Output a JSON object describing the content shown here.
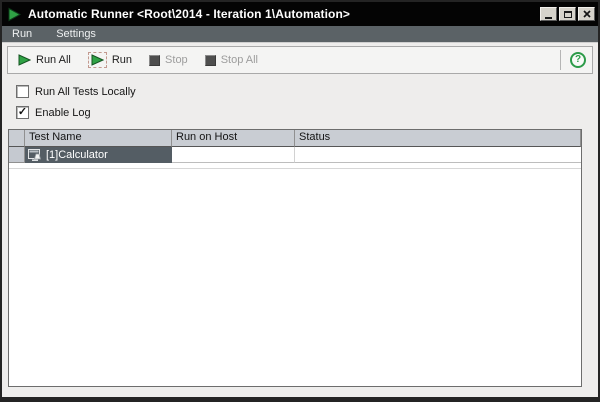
{
  "window": {
    "title": "Automatic Runner <Root\\2014 - Iteration 1\\Automation>",
    "icons": {
      "app": "play-icon",
      "minimize": "minimize-icon",
      "maximize": "maximize-icon",
      "close": "close-icon"
    }
  },
  "menu": {
    "items": [
      {
        "label": "Run"
      },
      {
        "label": "Settings"
      }
    ]
  },
  "toolbar": {
    "buttons": [
      {
        "label": "Run All",
        "icon": "play-icon",
        "enabled": true
      },
      {
        "label": "Run",
        "icon": "play-selected-icon",
        "enabled": true
      },
      {
        "label": "Stop",
        "icon": "stop-icon",
        "enabled": false
      },
      {
        "label": "Stop All",
        "icon": "stop-icon",
        "enabled": false
      }
    ],
    "help": {
      "icon": "help-icon",
      "glyph": "?"
    }
  },
  "options": {
    "run_all_tests_locally": {
      "label": "Run All Tests Locally",
      "checked": false,
      "glyph": ""
    },
    "enable_log": {
      "label": "Enable Log",
      "checked": true,
      "glyph": "✓"
    }
  },
  "table": {
    "columns": [
      "Test Name",
      "Run on Host",
      "Status"
    ],
    "rows": [
      {
        "icon": "test-icon",
        "test_name": "[1]Calculator",
        "run_on_host": "",
        "status": "",
        "selected": true
      }
    ]
  },
  "colors": {
    "accent_green": "#2c9b49",
    "titlebar": "#040404",
    "menubar": "#5b6266",
    "selection": "#545d64",
    "grid_header": "#c9cdd3"
  }
}
